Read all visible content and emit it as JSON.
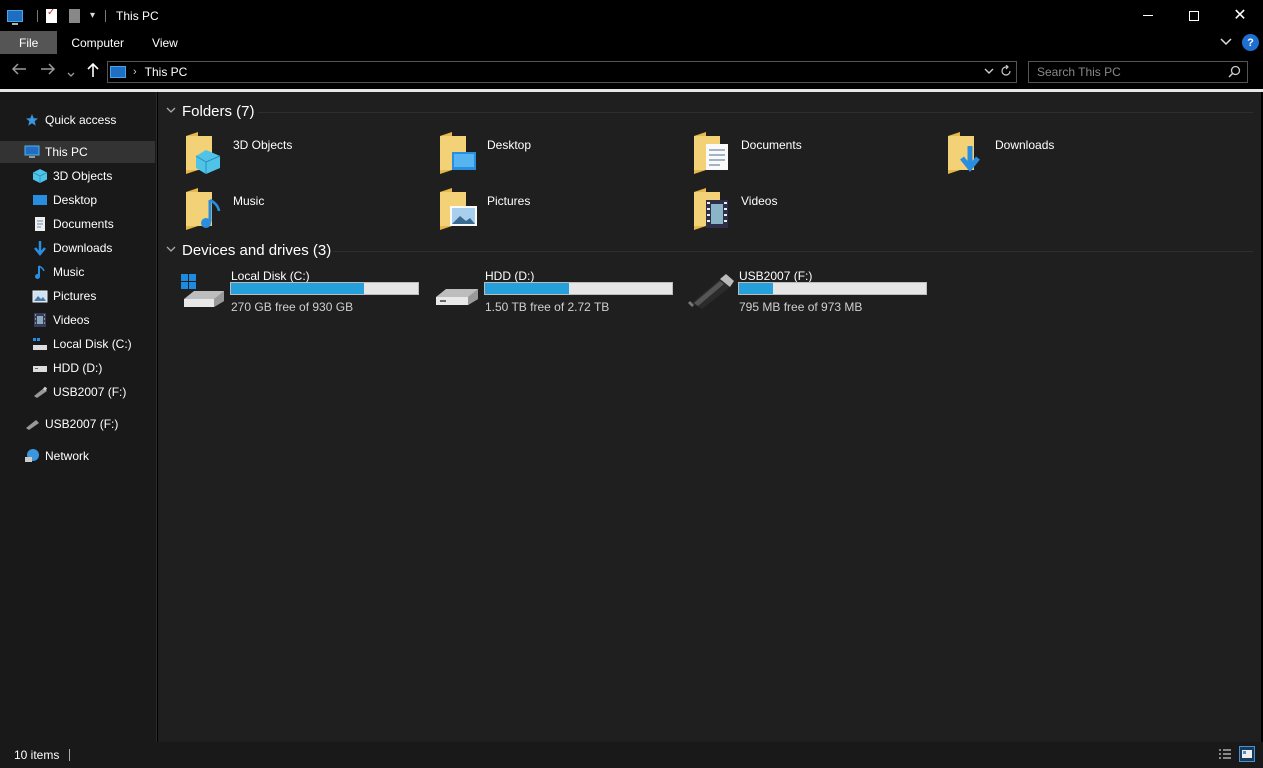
{
  "window": {
    "title": "This PC",
    "minimize_glyph": "",
    "close_glyph": "✕"
  },
  "ribbon": {
    "tabs": [
      "File",
      "Computer",
      "View"
    ],
    "help_glyph": "?"
  },
  "address": {
    "crumb": "This PC",
    "separator": "›"
  },
  "search": {
    "placeholder": "Search This PC"
  },
  "sidebar": {
    "quick_access": "Quick access",
    "this_pc": "This PC",
    "children": [
      "3D Objects",
      "Desktop",
      "Documents",
      "Downloads",
      "Music",
      "Pictures",
      "Videos",
      "Local Disk (C:)",
      "HDD (D:)",
      "USB2007 (F:)"
    ],
    "usb": "USB2007 (F:)",
    "network": "Network"
  },
  "folders": {
    "header": "Folders (7)",
    "items": [
      "3D Objects",
      "Desktop",
      "Documents",
      "Downloads",
      "Music",
      "Pictures",
      "Videos"
    ]
  },
  "drives": {
    "header": "Devices and drives (3)",
    "items": [
      {
        "name": "Local Disk (C:)",
        "free_text": "270 GB free of 930 GB",
        "used_fraction": 0.71
      },
      {
        "name": "HDD (D:)",
        "free_text": "1.50 TB free of 2.72 TB",
        "used_fraction": 0.45
      },
      {
        "name": "USB2007 (F:)",
        "free_text": "795 MB free of 973 MB",
        "used_fraction": 0.18
      }
    ]
  },
  "status": {
    "item_count": "10 items"
  },
  "colors": {
    "accent": "#26a0da",
    "folder": "#f3d277",
    "background": "#1f1f1f",
    "sidebar": "#191919"
  }
}
